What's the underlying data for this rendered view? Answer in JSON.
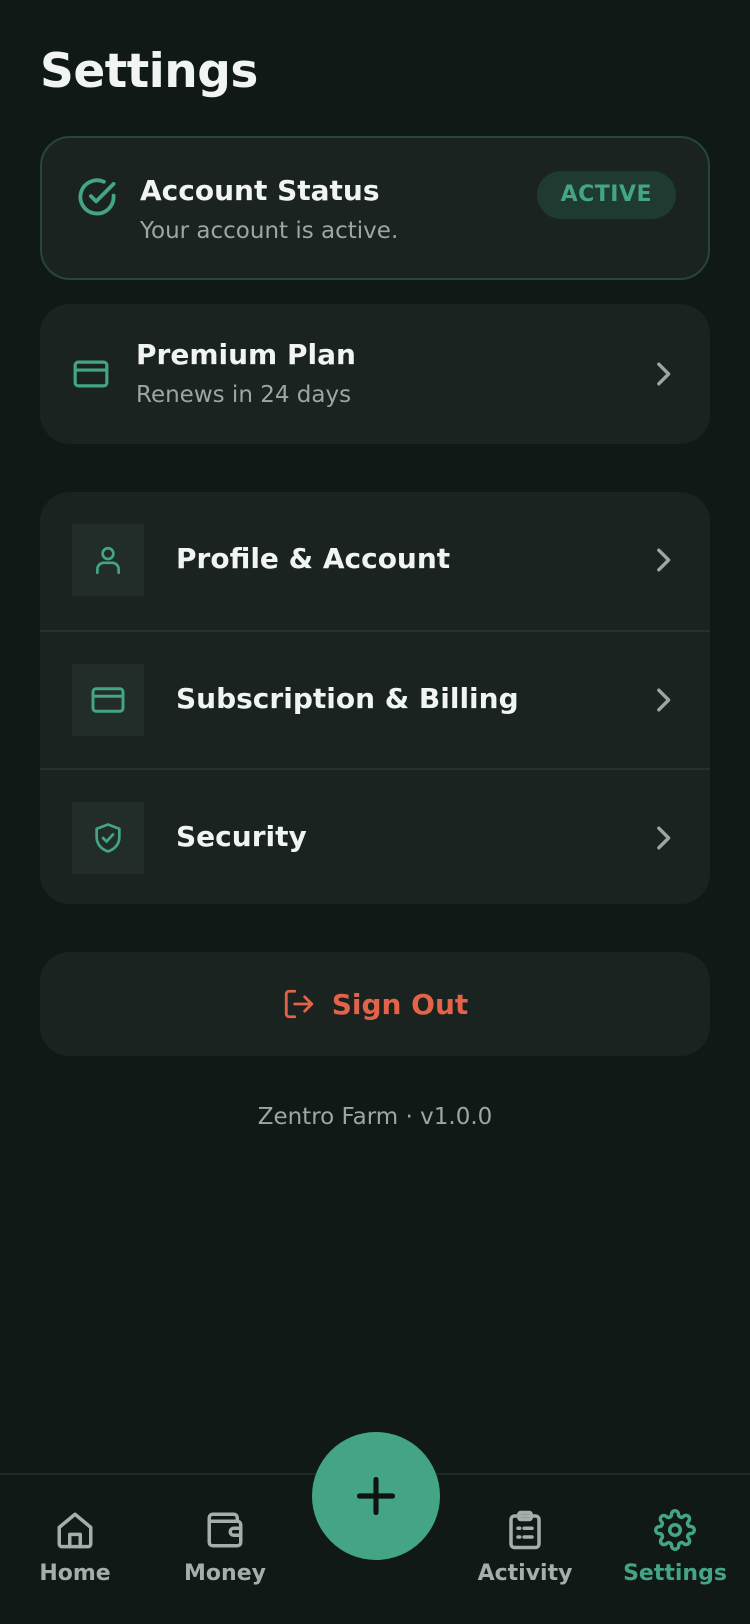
{
  "header": {
    "title": "Settings"
  },
  "status": {
    "title": "Account Status",
    "subtitle": "Your account is active.",
    "badge": "ACTIVE",
    "icon": "check-circle-icon"
  },
  "plan": {
    "title": "Premium Plan",
    "subtitle": "Renews in 24 days",
    "icon": "credit-card-icon"
  },
  "menu": {
    "items": [
      {
        "label": "Profile & Account",
        "icon": "user-icon"
      },
      {
        "label": "Subscription & Billing",
        "icon": "credit-card-icon"
      },
      {
        "label": "Security",
        "icon": "shield-check-icon"
      }
    ]
  },
  "signout": {
    "label": "Sign Out",
    "icon": "log-out-icon"
  },
  "footer": {
    "version": "Zentro Farm · v1.0.0"
  },
  "tabbar": {
    "items": [
      {
        "label": "Home",
        "icon": "home-icon",
        "active": false
      },
      {
        "label": "Money",
        "icon": "wallet-icon",
        "active": false
      },
      {
        "label": "Activity",
        "icon": "clipboard-list-icon",
        "active": false
      },
      {
        "label": "Settings",
        "icon": "gear-icon",
        "active": true
      }
    ],
    "fab_icon": "plus-icon"
  },
  "colors": {
    "background": "#111916",
    "card": "#1a231f",
    "accent": "#43a586",
    "danger": "#e2634a",
    "muted_text": "#9ba7a1"
  }
}
